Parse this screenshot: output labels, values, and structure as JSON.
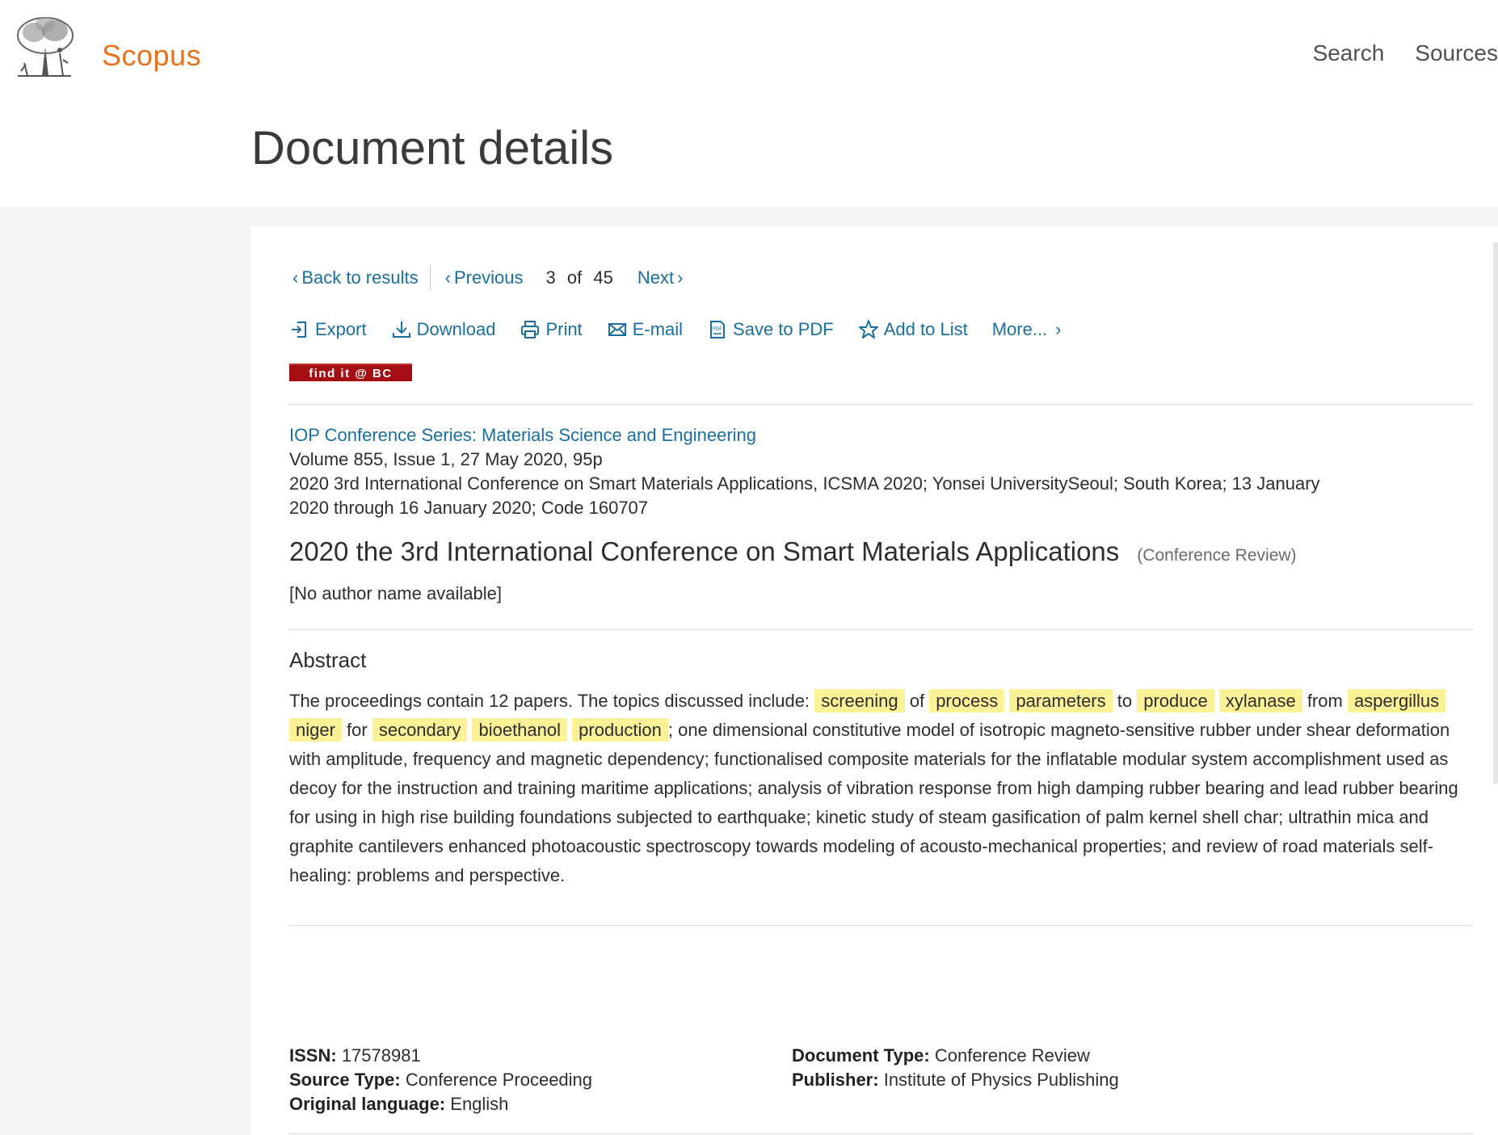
{
  "header": {
    "brand": "Scopus",
    "nav": [
      "Search",
      "Sources"
    ]
  },
  "page_title": "Document details",
  "results_nav": {
    "back": "Back to results",
    "previous": "Previous",
    "current": "3",
    "of": "of",
    "total": "45",
    "next": "Next"
  },
  "toolbar": {
    "export": "Export",
    "download": "Download",
    "print": "Print",
    "email": "E-mail",
    "save_pdf": "Save to PDF",
    "add_list": "Add to List",
    "more": "More..."
  },
  "findit_label": "find it @ BC",
  "source": {
    "journal": "IOP Conference Series: Materials Science and Engineering",
    "volume_line": "Volume 855, Issue 1, 27 May 2020, 95p",
    "conference_line": "2020 3rd International Conference on Smart Materials Applications, ICSMA 2020; Yonsei UniversitySeoul; South Korea; 13 January 2020 through 16 January 2020; Code 160707"
  },
  "document": {
    "title": "2020 the 3rd International Conference on Smart Materials Applications",
    "type_tag": "(Conference Review)",
    "authors": "[No author name available]"
  },
  "abstract": {
    "heading": "Abstract",
    "intro": "The proceedings contain 12 papers. The topics discussed include: ",
    "h1": "screening",
    "t1": " of ",
    "h2": "process",
    "t2": " ",
    "h3": "parameters",
    "t3": " to ",
    "h4": "produce",
    "t4": " ",
    "h5": "xylanase",
    "t5": " from ",
    "h6": "aspergillus",
    "t6": " ",
    "h7": "niger",
    "t7": " for ",
    "h8": "secondary",
    "t8": " ",
    "h9": "bioethanol",
    "t9": " ",
    "h10": "production",
    "rest": "; one dimensional constitutive model of isotropic magneto-sensitive rubber under shear deformation with amplitude, frequency and magnetic dependency; functionalised composite materials for the inflatable modular system accomplishment used as decoy for the instruction and training maritime applications; analysis of vibration response from high damping rubber bearing and lead rubber bearing for using in high rise building foundations subjected to earthquake; kinetic study of steam gasification of palm kernel shell char; ultrathin mica and graphite cantilevers enhanced photoacoustic spectroscopy towards modeling of acousto-mechanical properties; and review of road materials self-healing: problems and perspective."
  },
  "metadata": {
    "issn_label": "ISSN:",
    "issn": "17578981",
    "source_type_label": "Source Type:",
    "source_type": "Conference Proceeding",
    "language_label": "Original language:",
    "language": "English",
    "doc_type_label": "Document Type:",
    "doc_type": "Conference Review",
    "publisher_label": "Publisher:",
    "publisher": "Institute of Physics Publishing"
  },
  "colors": {
    "brand": "#e9711c",
    "link": "#1a6fa0",
    "highlight": "#fbf197",
    "findit": "#a50f13"
  }
}
